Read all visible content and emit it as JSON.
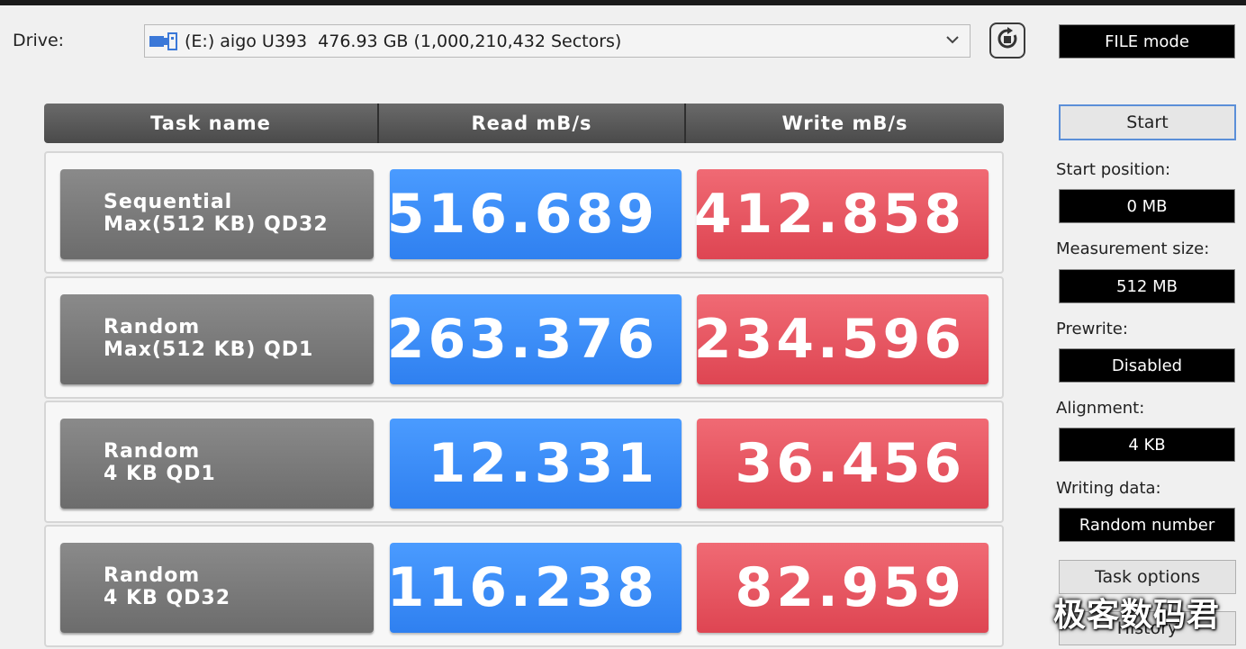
{
  "drive": {
    "label": "Drive:",
    "selected": "(E:) aigo U393  476.93 GB (1,000,210,432 Sectors)",
    "icon": "drive-icon"
  },
  "mode": "FILE mode",
  "table": {
    "headers": [
      "Task name",
      "Read mB/s",
      "Write mB/s"
    ],
    "rows": [
      {
        "task_line1": "Sequential",
        "task_line2": "Max(512 KB) QD32",
        "read": "516.689",
        "write": "412.858"
      },
      {
        "task_line1": "Random",
        "task_line2": "Max(512 KB) QD1",
        "read": "263.376",
        "write": "234.596"
      },
      {
        "task_line1": "Random",
        "task_line2": "4 KB QD1",
        "read": "12.331",
        "write": "36.456"
      },
      {
        "task_line1": "Random",
        "task_line2": "4 KB QD32",
        "read": "116.238",
        "write": "82.959"
      }
    ]
  },
  "side": {
    "start": "Start",
    "start_position_label": "Start position:",
    "start_position_value": "0 MB",
    "measurement_size_label": "Measurement size:",
    "measurement_size_value": "512 MB",
    "prewrite_label": "Prewrite:",
    "prewrite_value": "Disabled",
    "alignment_label": "Alignment:",
    "alignment_value": "4 KB",
    "writing_data_label": "Writing data:",
    "writing_data_value": "Random number",
    "task_options": "Task options",
    "history": "History"
  },
  "watermark": "极客数码君",
  "colors": {
    "read": "#2f80f0",
    "write": "#de4552",
    "task": "#7a7a7a",
    "header": "#555555"
  }
}
